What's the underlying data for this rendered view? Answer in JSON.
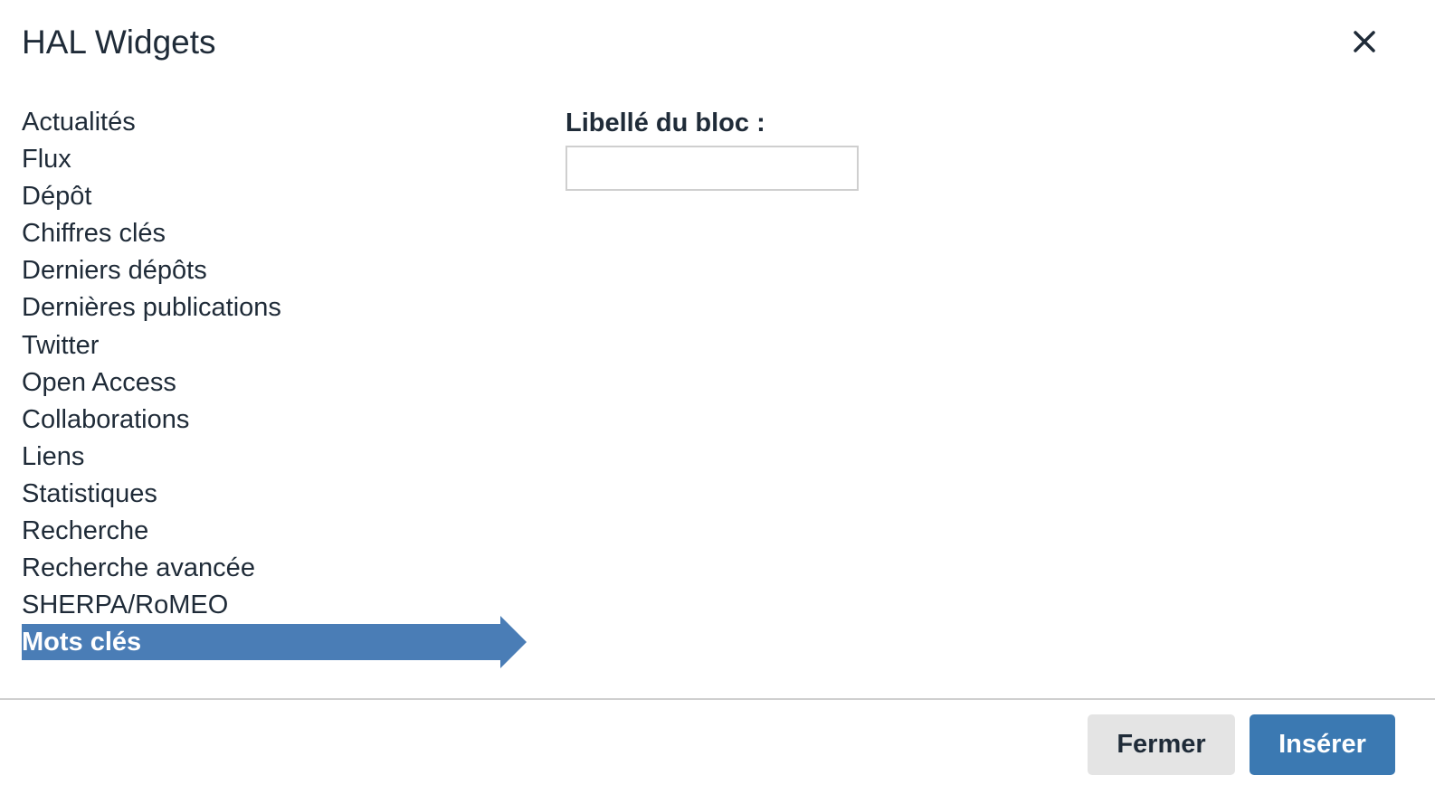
{
  "dialog": {
    "title": "HAL Widgets",
    "close_icon": "close-icon"
  },
  "widgets": {
    "items": [
      {
        "label": "Actualités"
      },
      {
        "label": "Flux"
      },
      {
        "label": "Dépôt"
      },
      {
        "label": "Chiffres clés"
      },
      {
        "label": "Derniers dépôts"
      },
      {
        "label": "Dernières publications"
      },
      {
        "label": "Twitter"
      },
      {
        "label": "Open Access"
      },
      {
        "label": "Collaborations"
      },
      {
        "label": "Liens"
      },
      {
        "label": "Statistiques"
      },
      {
        "label": "Recherche"
      },
      {
        "label": "Recherche avancée"
      },
      {
        "label": "SHERPA/RoMEO"
      },
      {
        "label": "Mots clés"
      }
    ],
    "selected": "Mots clés",
    "selected_color": "#4a7db6"
  },
  "form": {
    "block_label": "Libellé du bloc :",
    "block_value": ""
  },
  "footer": {
    "close_label": "Fermer",
    "insert_label": "Insérer",
    "insert_color": "#3b79b2"
  }
}
